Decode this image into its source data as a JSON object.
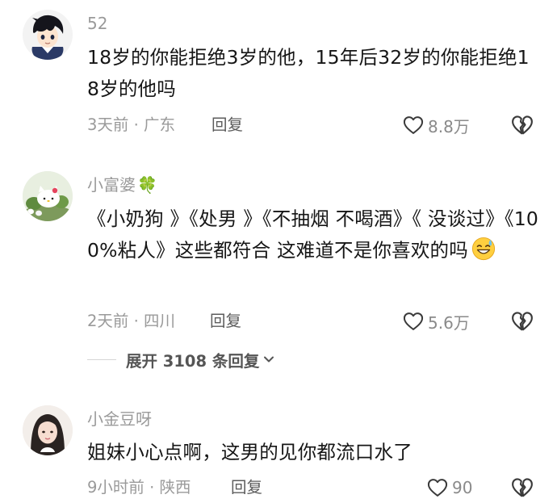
{
  "comments": [
    {
      "username": "52",
      "text": "18岁的你能拒绝3岁的他，15年后32岁的你能拒绝18岁的他吗",
      "time_location": "3天前 · 广东",
      "reply_label": "回复",
      "like_count": "8.8万",
      "avatar": "anime-boy-avatar"
    },
    {
      "username": "小富婆",
      "username_badge": "🍀",
      "text": "《小奶狗 》《处男 》《不抽烟 不喝酒》《 没谈过》《100%粘人》这些都符合 这难道不是你喜欢的吗",
      "emoji": "grinning-sweat-emoji",
      "time_location": "2天前 · 四川",
      "reply_label": "回复",
      "like_count": "5.6万",
      "avatar": "hello-kitty-avatar"
    },
    {
      "username": "小金豆呀",
      "text": "姐妹小心点啊，这男的见你都流口水了",
      "time_location": "9小时前 · 陕西",
      "reply_label": "回复",
      "like_count": "90",
      "avatar": "girl-photo-avatar"
    }
  ],
  "expand_replies": {
    "label": "展开 3108 条回复",
    "icon": "chevron-down-icon"
  },
  "icons": {
    "like": "heart-outline-icon",
    "dislike": "broken-heart-icon"
  },
  "colors": {
    "text": "#161616",
    "meta": "#9a9a9a",
    "icon": "#3a3a3a"
  }
}
